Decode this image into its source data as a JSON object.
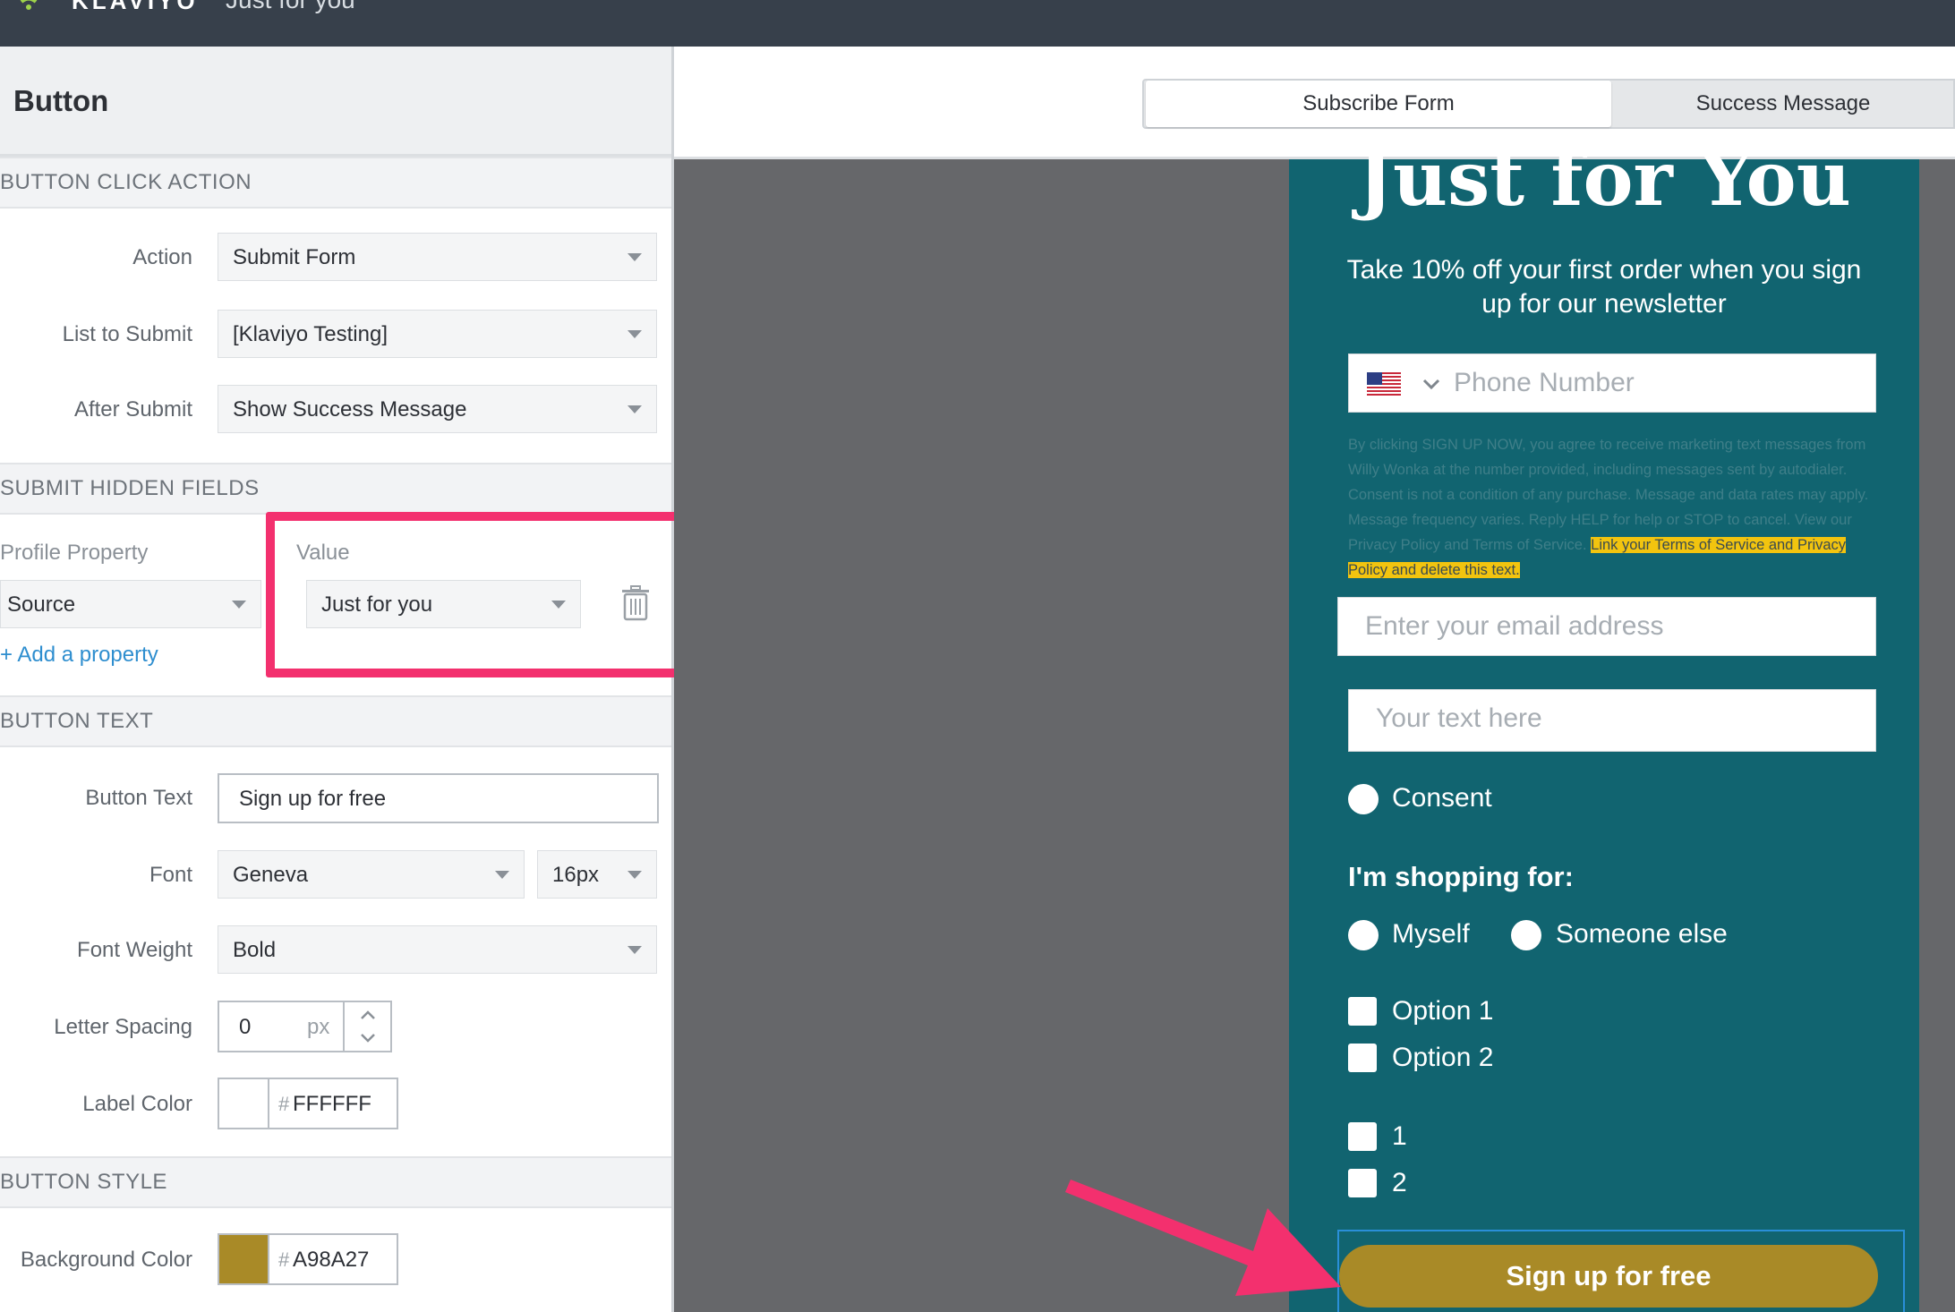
{
  "app": {
    "brand": "KLAVIYO",
    "document_title": "Just for you"
  },
  "panel": {
    "title": "Button",
    "click_action": {
      "heading": "BUTTON CLICK ACTION",
      "action_label": "Action",
      "action_value": "Submit Form",
      "list_label": "List to Submit",
      "list_value": "[Klaviyo Testing]",
      "after_label": "After Submit",
      "after_value": "Show Success Message"
    },
    "hidden_fields": {
      "heading": "SUBMIT HIDDEN FIELDS",
      "property_header": "Profile Property",
      "value_header": "Value",
      "property_value": "Source",
      "value_value": "Just for you",
      "add_link": "+ Add a property"
    },
    "button_text": {
      "heading": "BUTTON TEXT",
      "text_label": "Button Text",
      "text_value": "Sign up for free",
      "font_label": "Font",
      "font_value": "Geneva",
      "font_size": "16px",
      "weight_label": "Font Weight",
      "weight_value": "Bold",
      "spacing_label": "Letter Spacing",
      "spacing_value": "0",
      "spacing_unit": "px",
      "color_label": "Label Color",
      "color_hash": "#",
      "color_value": "FFFFFF"
    },
    "button_style": {
      "heading": "BUTTON STYLE",
      "bg_label": "Background Color",
      "bg_hash": "#",
      "bg_value": "A98A27"
    }
  },
  "tabs": {
    "subscribe": "Subscribe Form",
    "success": "Success Message"
  },
  "form": {
    "title": "Just for You",
    "subtitle": "Take 10% off your first order when you sign up for our newsletter",
    "phone_placeholder": "Phone Number",
    "disclaimer": "By clicking SIGN UP NOW, you agree to receive marketing text messages from Willy Wonka at the number provided, including messages sent by autodialer. Consent is not a condition of any purchase. Message and data rates may apply. Message frequency varies. Reply HELP for help or STOP to cancel. View our Privacy Policy and Terms of Service.",
    "disclaimer_highlight": "Link your Terms of Service and Privacy Policy and delete this text.",
    "email_placeholder": "Enter your email address",
    "text_placeholder": "Your text here",
    "consent_label": "Consent",
    "shopping_heading": "I'm shopping for:",
    "radio_myself": "Myself",
    "radio_someone": "Someone else",
    "option1": "Option 1",
    "option2": "Option 2",
    "check1": "1",
    "check2": "2",
    "submit_label": "Sign up for free"
  },
  "colors": {
    "accent_pink": "#F3306E",
    "form_bg": "#116470",
    "button_bg": "#A98A27"
  }
}
